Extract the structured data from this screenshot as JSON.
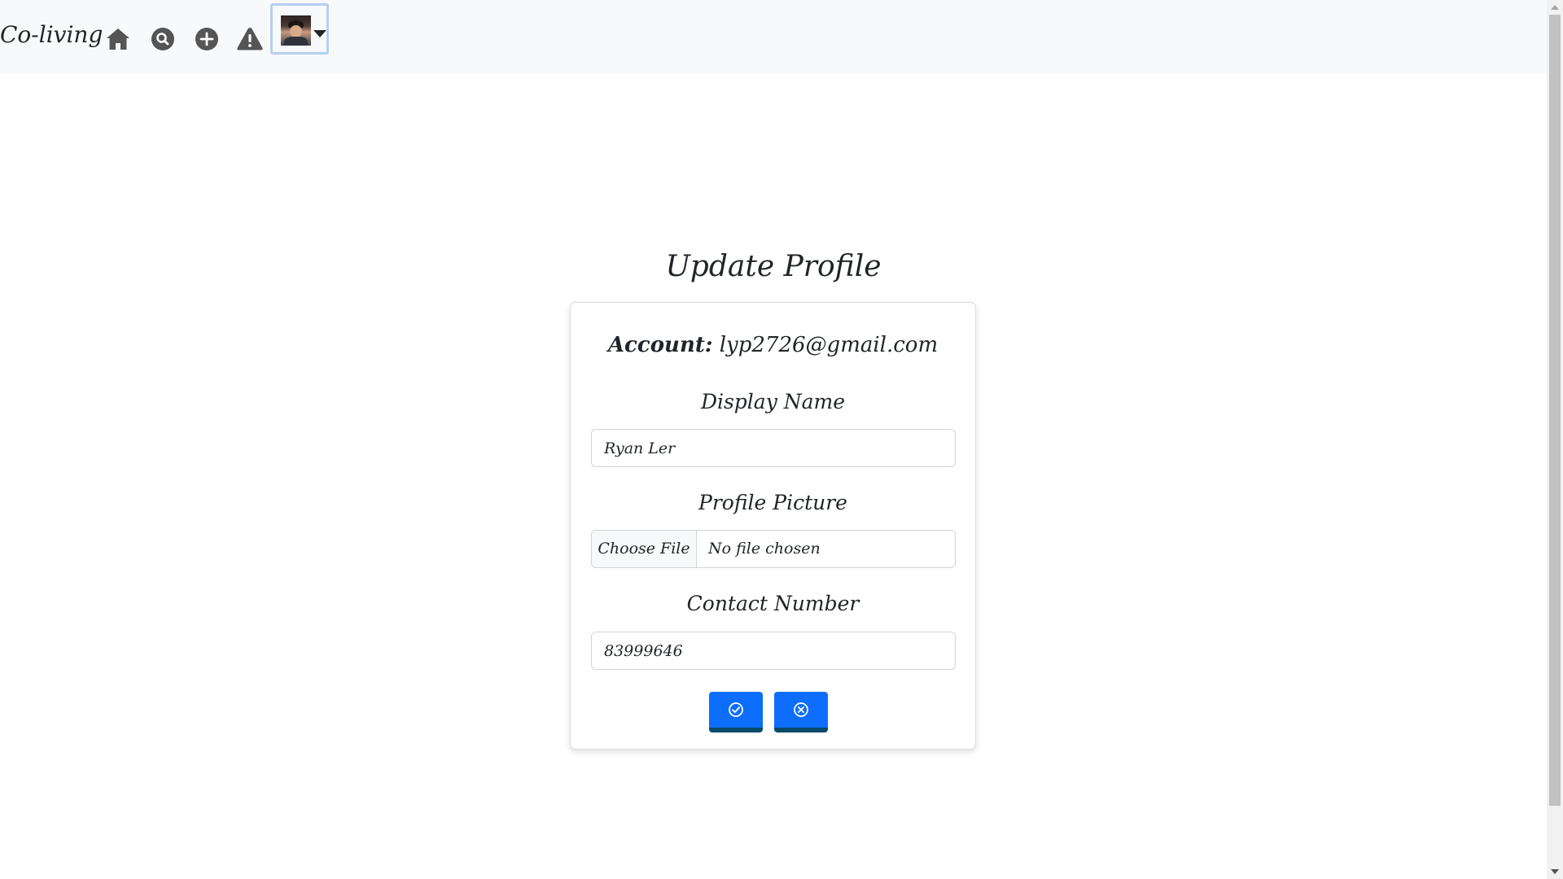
{
  "navbar": {
    "brand": "Co-living",
    "icons": [
      "home-icon",
      "search-icon",
      "add-icon",
      "warning-icon"
    ],
    "user_menu": {
      "avatar": "user-avatar",
      "caret": "caret-down-icon"
    }
  },
  "page": {
    "title": "Update Profile"
  },
  "form": {
    "account_label": "Account:",
    "account_value": "lyp2726@gmail.com",
    "display_name_label": "Display Name",
    "display_name_value": "Ryan Ler",
    "profile_picture_label": "Profile Picture",
    "choose_file_label": "Choose File",
    "file_status": "No file chosen",
    "contact_number_label": "Contact Number",
    "contact_number_value": "83999646",
    "confirm_icon": "check-circle-icon",
    "cancel_icon": "x-circle-icon"
  },
  "colors": {
    "primary": "#0d6efd",
    "navbar_bg": "#f8f9fa",
    "icon": "#555555"
  }
}
